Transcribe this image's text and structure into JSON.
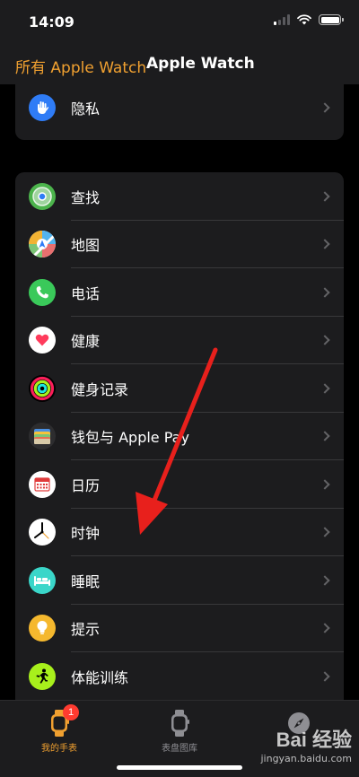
{
  "status_bar": {
    "time": "14:09"
  },
  "nav": {
    "back_label": "所有 Apple Watch",
    "title": "Apple Watch"
  },
  "section_top": {
    "items": [
      {
        "label": "隐私",
        "icon": "privacy-hand-icon"
      }
    ]
  },
  "section_apps": {
    "items": [
      {
        "label": "查找",
        "icon": "find-my-icon"
      },
      {
        "label": "地图",
        "icon": "maps-icon"
      },
      {
        "label": "电话",
        "icon": "phone-icon"
      },
      {
        "label": "健康",
        "icon": "health-icon"
      },
      {
        "label": "健身记录",
        "icon": "activity-icon"
      },
      {
        "label": "钱包与 Apple Pay",
        "icon": "wallet-icon"
      },
      {
        "label": "日历",
        "icon": "calendar-icon"
      },
      {
        "label": "时钟",
        "icon": "clock-icon"
      },
      {
        "label": "睡眠",
        "icon": "sleep-icon"
      },
      {
        "label": "提示",
        "icon": "tips-icon"
      },
      {
        "label": "体能训练",
        "icon": "workout-icon"
      }
    ]
  },
  "tab_bar": {
    "tabs": [
      {
        "label": "我的手表",
        "icon": "watch-icon",
        "badge": "1",
        "active": true
      },
      {
        "label": "表盘图库",
        "icon": "face-gallery-icon",
        "active": false
      },
      {
        "label": "",
        "icon": "discover-compass-icon",
        "active": false
      }
    ]
  },
  "watermark": {
    "brand": "Bai 经验",
    "url": "jingyan.baidu.com"
  },
  "colors": {
    "accent": "#f0a030",
    "background": "#000000",
    "card": "#1c1c1e",
    "arrow": "#e8201c"
  }
}
